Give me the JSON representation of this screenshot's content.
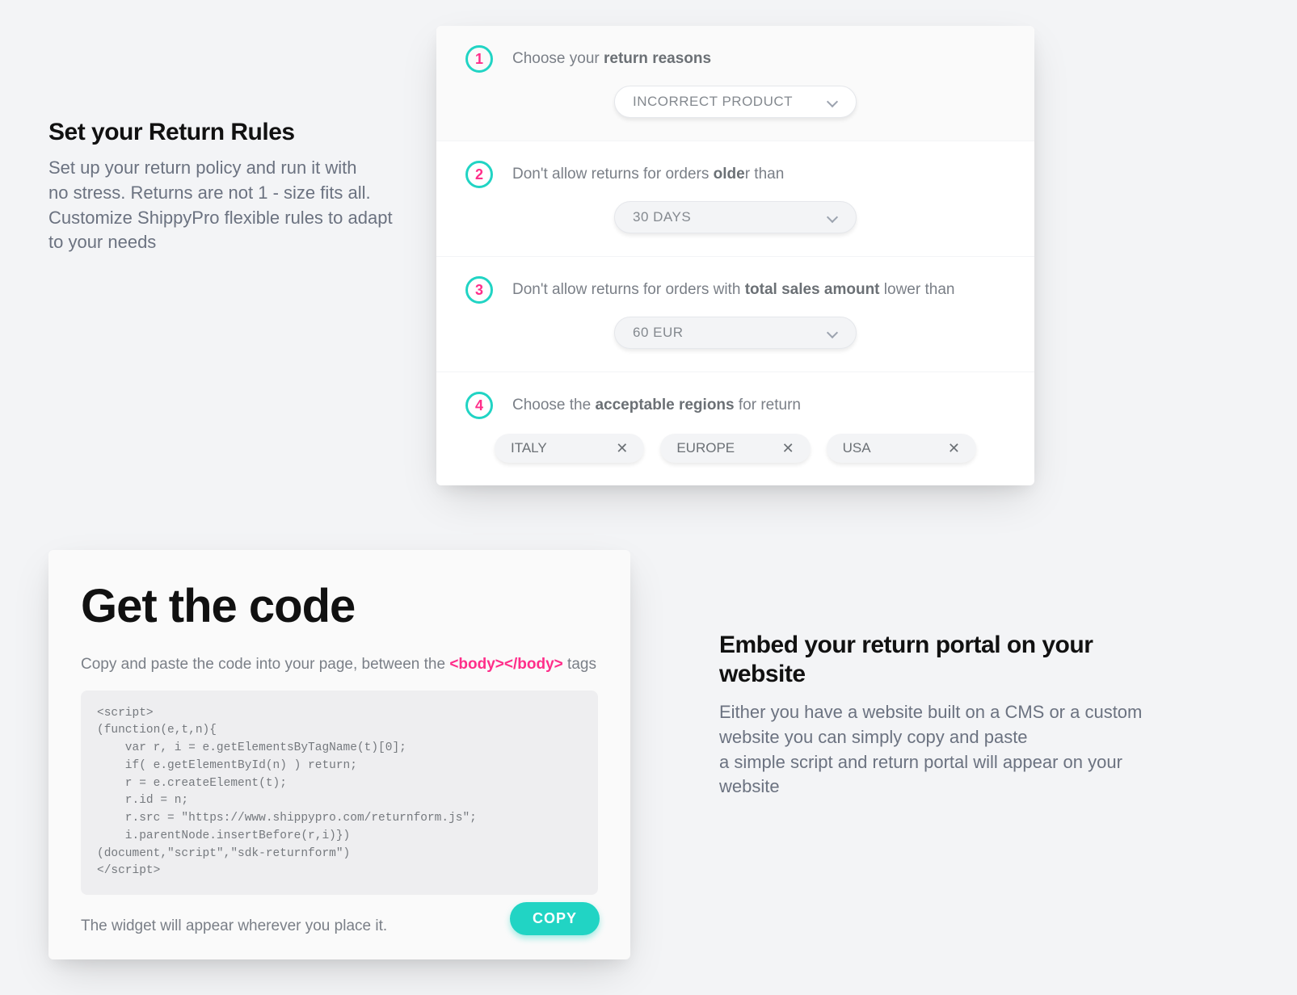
{
  "section1": {
    "title": "Set your Return Rules",
    "body_line1": "Set up your return policy and run it with",
    "body_line2": "no stress. Returns are not 1 - size fits all.",
    "body_line3": "Customize ShippyPro flexible rules to adapt to your needs"
  },
  "rules": {
    "r1": {
      "num": "1",
      "pre": "Choose your ",
      "bold": "return reasons",
      "post": "",
      "value": "INCORRECT PRODUCT"
    },
    "r2": {
      "num": "2",
      "pre": "Don't allow returns for orders ",
      "bold": "olde",
      "post": "r than",
      "value": "30 DAYS"
    },
    "r3": {
      "num": "3",
      "pre": "Don't allow returns for orders with ",
      "bold": "total sales amount",
      "post": " lower than",
      "value": "60 EUR"
    },
    "r4": {
      "num": "4",
      "pre": "Choose the ",
      "bold": "acceptable regions",
      "post": " for return",
      "tags": {
        "t0": "ITALY",
        "t1": "EUROPE",
        "t2": "USA"
      }
    }
  },
  "code": {
    "title": "Get the code",
    "instr_pre": "Copy and paste the code into your page, between the ",
    "instr_tag": "<body></body>",
    "instr_post": "  tags",
    "snippet": "<script>\n(function(e,t,n){\n    var r, i = e.getElementsByTagName(t)[0];\n    if( e.getElementById(n) ) return;\n    r = e.createElement(t);\n    r.id = n;\n    r.src = \"https://www.shippypro.com/returnform.js\";\n    i.parentNode.insertBefore(r,i)})\n(document,\"script\",\"sdk-returnform\")\n</script>",
    "note": "The widget will appear wherever you place it.",
    "copy_label": "COPY"
  },
  "section2": {
    "title": "Embed your return portal on your website",
    "body_line1": "Either you have a website built on a CMS or a custom website you can simply copy and paste",
    "body_line2": "a simple script and return portal will appear on your website"
  },
  "colors": {
    "accent_teal": "#21d4c4",
    "accent_pink": "#ff2e8a"
  }
}
